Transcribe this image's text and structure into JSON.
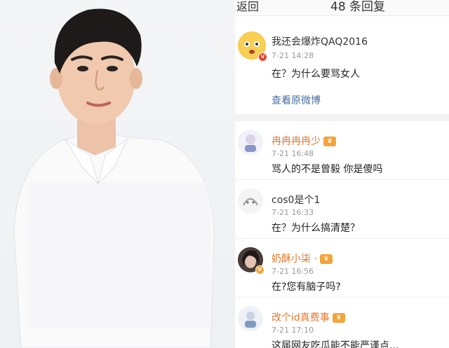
{
  "header": {
    "back_label": "返回",
    "title": "48 条回复"
  },
  "main_post": {
    "author": "我还会爆炸QAQ2016",
    "time": "7-21 14:28",
    "text": "在？为什么要骂女人",
    "view_original": "查看原微博"
  },
  "comments": [
    {
      "author": "冉冉冉冉少",
      "time": "7-21 16:48",
      "text": "骂人的不是曾毅 你是傻吗",
      "badge": "vip"
    },
    {
      "author": "cos0是个1",
      "time": "7-21 16:33",
      "text": "在？为什么搞清楚？",
      "badge": ""
    },
    {
      "author": "奶酥小柒 ·",
      "time": "7-21 16:56",
      "text": "在?您有脑子吗?",
      "badge": "vip"
    },
    {
      "author": "改个id真费事",
      "time": "7-21 17:10",
      "text": "这届网友吃瓜能不能严谨点...",
      "badge": "vip"
    }
  ],
  "colors": {
    "link_name": "#e8782e",
    "default_name": "#333333",
    "link": "#4a6fa0",
    "time": "#999999"
  },
  "icons": {
    "back": "chevron-left-icon",
    "vip": "crown-badge-icon",
    "verified": "verified-badge-icon"
  }
}
